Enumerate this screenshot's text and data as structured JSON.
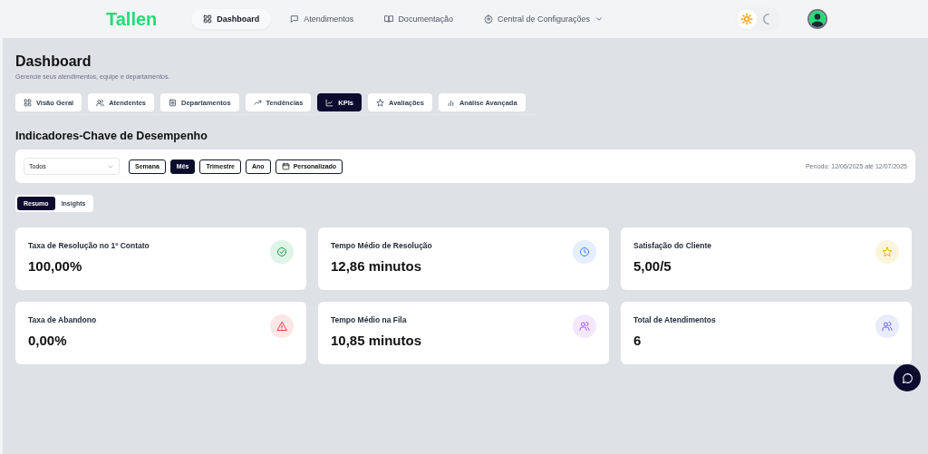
{
  "brand": "Tallen",
  "nav": [
    {
      "label": "Dashboard",
      "kind": "grid",
      "selected": true
    },
    {
      "label": "Atendimentos",
      "kind": "chat",
      "selected": false
    },
    {
      "label": "Documentação",
      "kind": "book",
      "selected": false
    },
    {
      "label": "Central de Configurações",
      "kind": "gear",
      "selected": false,
      "dropdown": true
    }
  ],
  "theme": {
    "light_selected": true
  },
  "page": {
    "title": "Dashboard",
    "subtitle": "Gerencie seus atendimentos, equipe e departamentos."
  },
  "tabs": [
    {
      "label": "Visão Geral",
      "kind": "grid",
      "selected": false
    },
    {
      "label": "Atendentes",
      "kind": "users",
      "selected": false
    },
    {
      "label": "Departamentos",
      "kind": "building",
      "selected": false
    },
    {
      "label": "Tendências",
      "kind": "trend",
      "selected": false
    },
    {
      "label": "KPIs",
      "kind": "chart",
      "selected": true
    },
    {
      "label": "Avaliações",
      "kind": "star",
      "selected": false
    },
    {
      "label": "Análise Avançada",
      "kind": "bars",
      "selected": false
    }
  ],
  "section_title": "Indicadores-Chave de Desempenho",
  "filters": {
    "select_value": "Todos",
    "periods": [
      {
        "label": "Semana",
        "selected": false
      },
      {
        "label": "Mês",
        "selected": true
      },
      {
        "label": "Trimestre",
        "selected": false
      },
      {
        "label": "Ano",
        "selected": false
      },
      {
        "label": "Personalizado",
        "selected": false,
        "kind": "calendar"
      }
    ],
    "period_text": "Período: 12/06/2025 até 12/07/2025"
  },
  "views": [
    {
      "label": "Resumo",
      "selected": true
    },
    {
      "label": "Insights",
      "selected": false
    }
  ],
  "kpis": [
    {
      "label": "Taxa de Resolução no 1º Contato",
      "value": "100,00%",
      "kind": "check"
    },
    {
      "label": "Tempo Médio de Resolução",
      "value": "12,86 minutos",
      "kind": "clock"
    },
    {
      "label": "Satisfação do Cliente",
      "value": "5,00/5",
      "kind": "star"
    },
    {
      "label": "Taxa de Abandono",
      "value": "0,00%",
      "kind": "alert"
    },
    {
      "label": "Tempo Médio na Fila",
      "value": "10,85 minutos",
      "kind": "queue"
    },
    {
      "label": "Total de Atendimentos",
      "value": "6",
      "kind": "total"
    }
  ]
}
